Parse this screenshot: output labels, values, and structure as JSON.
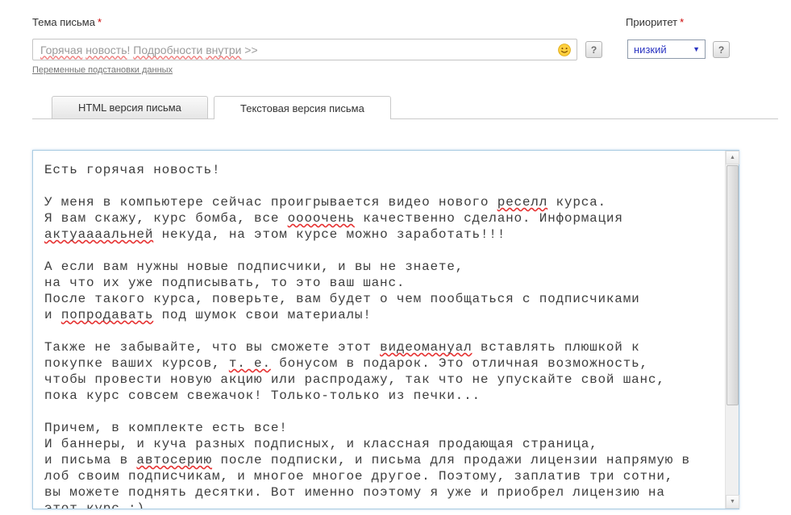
{
  "subject": {
    "label": "Тема письма",
    "required_mark": "*",
    "value": "Горячая новость! Подробности внутри >>",
    "misspelled": [
      "Горячая",
      "новость",
      "Подробности",
      "внутри"
    ],
    "help_label": "?",
    "substitution_link": "Переменные подстановки данных"
  },
  "priority": {
    "label": "Приоритет",
    "required_mark": "*",
    "selected_option": "низкий",
    "help_label": "?"
  },
  "tabs": [
    {
      "label": "HTML версия письма",
      "active": false
    },
    {
      "label": "Текстовая версия письма",
      "active": true
    }
  ],
  "editor": {
    "lines": [
      "Есть горячая новость!",
      "",
      "У меня в компьютере сейчас проигрывается видео нового реселл курса.",
      "Я вам скажу, курс бомба, все оооочень качественно сделано. Информация",
      "актуаааальней некуда, на этом курсе можно заработать!!!",
      "",
      "А если вам нужны новые подписчики, и вы не знаете,",
      "на что их уже подписывать, то это ваш шанс.",
      "После такого курса, поверьте, вам будет о чем пообщаться с подписчиками",
      "и попродавать под шумок свои материалы!",
      "",
      "Также не забывайте, что вы сможете этот видеомануал вставлять плюшкой к",
      "покупке ваших курсов, т. е. бонусом в подарок. Это отличная возможность,",
      "чтобы провести новую акцию или распродажу, так что не упускайте свой шанс,",
      "пока курс совсем свежачок! Только-только из печки...",
      "",
      "Причем, в комплекте есть все!",
      "И баннеры, и куча разных подписных, и классная продающая страница,",
      "и письма в автосерию после подписки, и письма для продажи лицензии напрямую в",
      "лоб своим подписчикам, и многое многое другое. Поэтому, заплатив три сотни,",
      "вы можете поднять десятки. Вот именно поэтому я уже и приобрел лицензию на",
      "этот курс :)"
    ],
    "misspelled": [
      "реселл",
      "оооочень",
      "актуаааальней",
      "попродавать",
      "видеомануал",
      "т. е.",
      "автосерию"
    ],
    "spellcheck_color": "#e63232"
  },
  "icons": {
    "scroll_up": "▲",
    "scroll_down": "▼",
    "select_arrow": "▼"
  },
  "colors": {
    "required_red": "#cc0000",
    "editor_border_blue": "#a9cbe2",
    "select_text_blue": "#2b35c2"
  }
}
